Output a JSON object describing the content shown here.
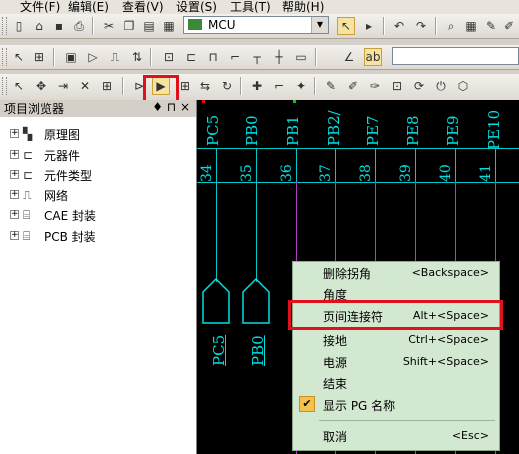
{
  "menubar": {
    "items": [
      "文件(F)",
      "编辑(E)",
      "查看(V)",
      "设置(S)",
      "工具(T)",
      "帮助(H)"
    ]
  },
  "toolbar1": {
    "combo_value": "MCU"
  },
  "panel": {
    "title": "项目浏览器",
    "pin": "♦ ⊓ ×",
    "tree": [
      {
        "label": "原理图",
        "icon": "schematic-icon"
      },
      {
        "label": "元器件",
        "icon": "component-icon"
      },
      {
        "label": "元件类型",
        "icon": "component-type-icon"
      },
      {
        "label": "网络",
        "icon": "net-icon"
      },
      {
        "label": "CAE 封装",
        "icon": "cae-decal-icon"
      },
      {
        "label": "PCB 封装",
        "icon": "pcb-decal-icon"
      }
    ]
  },
  "canvas": {
    "pins": [
      {
        "name": "PC5",
        "num": "34"
      },
      {
        "name": "PB0",
        "num": "35"
      },
      {
        "name": "PB1",
        "num": "36"
      },
      {
        "name": "PB2/",
        "num": "37"
      },
      {
        "name": "PE7",
        "num": "38"
      },
      {
        "name": "PE8",
        "num": "39"
      },
      {
        "name": "PE9",
        "num": "40"
      },
      {
        "name": "PE10",
        "num": "41"
      }
    ],
    "offpage": [
      "PC5",
      "PB0"
    ]
  },
  "context_menu": {
    "items": [
      {
        "label": "删除拐角",
        "shortcut": "<Backspace>"
      },
      {
        "label": "角度",
        "shortcut": ""
      },
      {
        "label": "页间连接符",
        "shortcut": "Alt+<Space>"
      },
      {
        "label": "接地",
        "shortcut": "Ctrl+<Space>"
      },
      {
        "label": "电源",
        "shortcut": "Shift+<Space>"
      },
      {
        "label": "结束",
        "shortcut": ""
      },
      {
        "label": "显示 PG 名称",
        "shortcut": ""
      },
      {
        "label": "取消",
        "shortcut": "<Esc>"
      }
    ]
  },
  "colors": {
    "highlight": "#e0101c",
    "pin_text": "#00e0e0",
    "menu_bg": "#d3e8d0"
  }
}
